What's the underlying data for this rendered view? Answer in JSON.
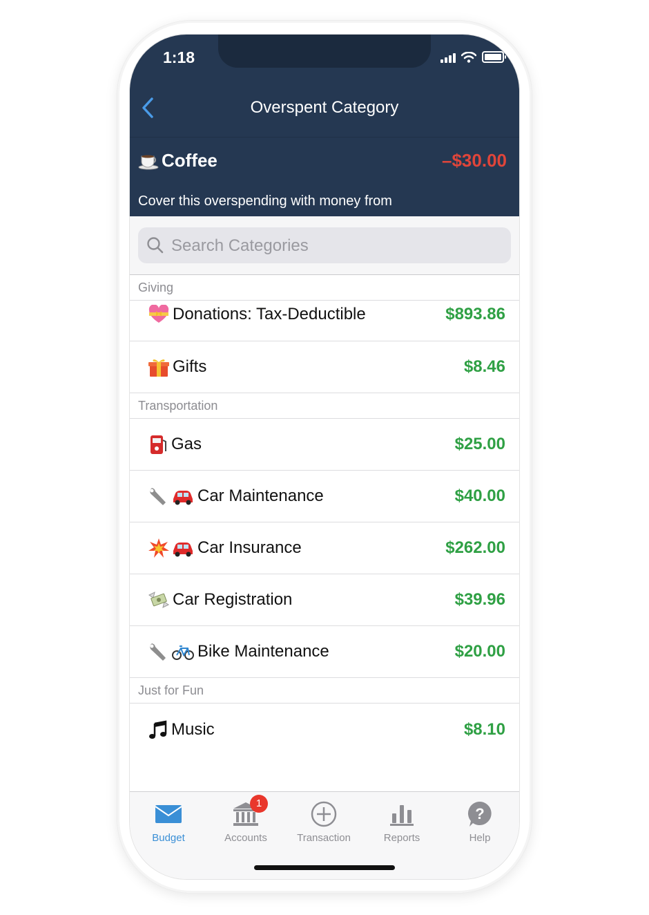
{
  "status_bar": {
    "time": "1:18"
  },
  "nav": {
    "title": "Overspent Category"
  },
  "overspent": {
    "category": "Coffee",
    "amount": "–$30.00",
    "cover_text": "Cover this overspending with money from"
  },
  "search": {
    "placeholder": "Search Categories"
  },
  "sections": [
    {
      "title": "Giving",
      "rows": [
        {
          "emoji": "heart-ribbon-icon",
          "name": "Donations: Tax-Deductible",
          "amount": "$893.86"
        },
        {
          "emoji": "gift-icon",
          "name": "Gifts",
          "amount": "$8.46"
        }
      ]
    },
    {
      "title": "Transportation",
      "rows": [
        {
          "emoji": "fuel-pump-icon",
          "name": "Gas",
          "amount": "$25.00"
        },
        {
          "emoji": "wrench-car-icon",
          "name": "Car Maintenance",
          "amount": "$40.00"
        },
        {
          "emoji": "collision-car-icon",
          "name": "Car Insurance",
          "amount": "$262.00"
        },
        {
          "emoji": "money-wings-icon",
          "name": "Car Registration",
          "amount": "$39.96"
        },
        {
          "emoji": "wrench-bicycle-icon",
          "name": "Bike Maintenance",
          "amount": "$20.00"
        }
      ]
    },
    {
      "title": "Just for Fun",
      "rows": [
        {
          "emoji": "music-notes-icon",
          "name": "Music",
          "amount": "$8.10"
        }
      ]
    }
  ],
  "tabbar": {
    "budget": "Budget",
    "accounts": "Accounts",
    "accounts_badge": "1",
    "transaction": "Transaction",
    "reports": "Reports",
    "help": "Help"
  },
  "colors": {
    "header_bg": "#253852",
    "negative": "#e0453a",
    "positive": "#2fa044",
    "active_tab": "#3a8fd6"
  }
}
